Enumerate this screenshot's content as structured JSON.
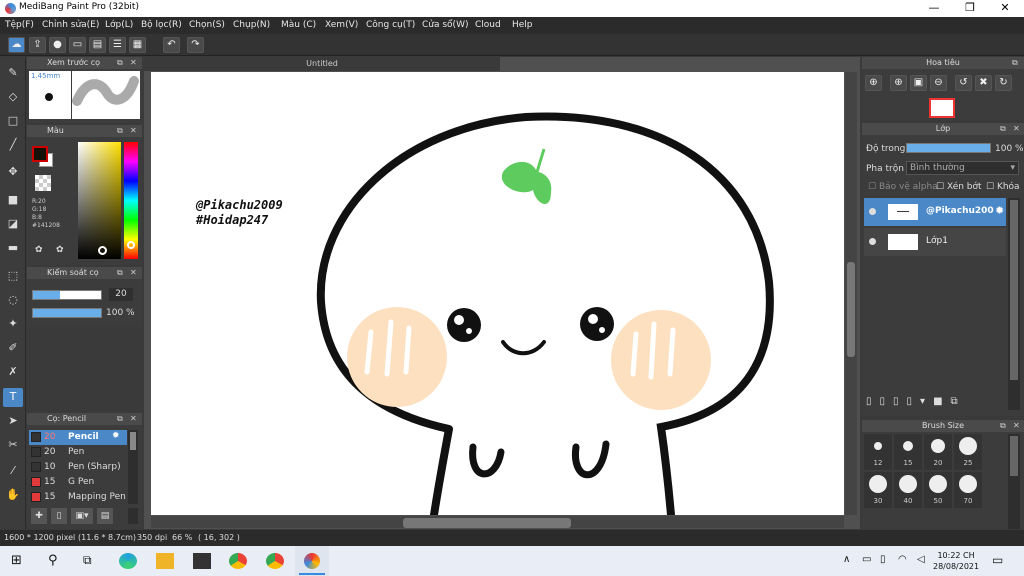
{
  "app": {
    "title": "MediBang Paint Pro (32bit)",
    "window_controls": {
      "minimize": "—",
      "maximize": "❐",
      "close": "✕"
    }
  },
  "menu": [
    "Tệp(F)",
    "Chỉnh sửa(E)",
    "Lớp(L)",
    "Bộ lọc(R)",
    "Chọn(S)",
    "Chụp(N)",
    "Màu (C)",
    "Xem(V)",
    "Công cụ(T)",
    "Cửa sổ(W)",
    "Cloud",
    "Help"
  ],
  "toolbar": {
    "undo": "↶",
    "redo": "↷"
  },
  "document": {
    "tab": "Untitled"
  },
  "brush_preview": {
    "title": "Xem trước cọ",
    "size_label": "1.45mm"
  },
  "color": {
    "title": "Màu",
    "fg": "#141208",
    "readout": {
      "r": "R:20",
      "g": "G:18",
      "b": "B:8",
      "hex": "#141208"
    }
  },
  "brush_control": {
    "title": "Kiểm soát cọ",
    "size": "20",
    "opacity": "100 %",
    "size_fraction": 0.4,
    "opacity_fraction": 1.0
  },
  "brush_list": {
    "title": "Cọ: Pencil",
    "items": [
      {
        "size": "20",
        "name": "Pencil",
        "color": "#333333",
        "selected": true
      },
      {
        "size": "20",
        "name": "Pen",
        "color": "#333333"
      },
      {
        "size": "10",
        "name": "Pen (Sharp)",
        "color": "#333333"
      },
      {
        "size": "15",
        "name": "G Pen",
        "color": "#e03a3a"
      },
      {
        "size": "15",
        "name": "Mapping Pen",
        "color": "#e03a3a"
      }
    ]
  },
  "navigator": {
    "title": "Hoa tiêu"
  },
  "layer": {
    "title": "Lớp",
    "opacity_label": "Độ trong",
    "opacity_value": "100 %",
    "opacity_fraction": 1.0,
    "blend_label": "Pha trộn",
    "blend_value": "Bình thường",
    "protect_alpha": "Bảo vệ alpha",
    "clipping": "Xén bớt",
    "lock": "Khóa",
    "layers": [
      {
        "name": "@Pikachu200",
        "selected": true
      },
      {
        "name": "Lớp1",
        "selected": false
      }
    ]
  },
  "brush_size": {
    "title": "Brush Size",
    "sizes": [
      "12",
      "15",
      "20",
      "25",
      "30",
      "40",
      "50",
      "70"
    ]
  },
  "canvas_text": {
    "line1": "@Pikachu2009",
    "line2": "#Hoidap247"
  },
  "status": {
    "dimensions": "1600 * 1200 pixel",
    "size_cm": "(11.6 * 8.7cm)",
    "dpi": "350 dpi",
    "zoom": "66 %",
    "coords": "( 16, 302 )"
  },
  "taskbar": {
    "time": "10:22 CH",
    "date": "28/08/2021"
  },
  "colors": {
    "accent": "#4a88c7",
    "panel": "#3c3c3c",
    "face_blush": "#fde0c0",
    "leaf": "#5ecb5e"
  }
}
